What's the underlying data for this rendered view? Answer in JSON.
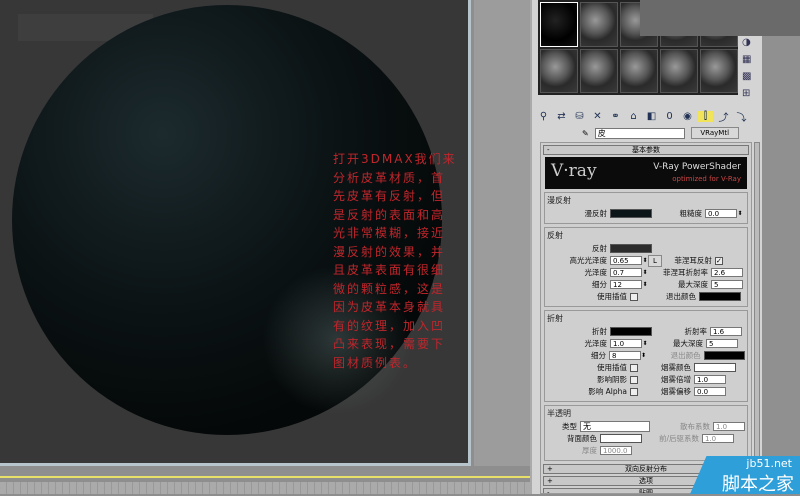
{
  "note_text": "打开3DMAX我们来分析皮革材质，首先皮革有反射，但是反射的表面和高光非常模糊，接近漫反射的效果，并且皮革表面有很细微的颗粒感，这是因为皮革本身就具有的纹理，加入凹凸来表现，需要下图材质例表。",
  "material_editor": {
    "material_name": "皮",
    "material_type": "VRayMtl",
    "rollout_basic": "基本参数",
    "banner": {
      "logo": "V·ray",
      "title": "V-Ray PowerShader",
      "subtitle": "optimized for V-Ray"
    },
    "diffuse": {
      "group": "漫反射",
      "diffuse_label": "漫反射",
      "roughness_label": "粗糙度",
      "roughness": "0.0"
    },
    "reflection": {
      "group": "反射",
      "reflect_label": "反射",
      "hilight_gloss_label": "高光光泽度",
      "hilight_gloss": "0.65",
      "L": "L",
      "gloss_label": "光泽度",
      "gloss": "0.7",
      "subdivs_label": "细分",
      "subdivs": "12",
      "interp_label": "使用插值",
      "fresnel_label": "菲涅耳反射",
      "fresnel_ior_label": "菲涅耳折射率",
      "fresnel_ior": "2.6",
      "max_depth_label": "最大深度",
      "max_depth": "5",
      "exit_color_label": "退出颜色"
    },
    "refraction": {
      "group": "折射",
      "refract_label": "折射",
      "ior_label": "折射率",
      "ior": "1.6",
      "gloss_label": "光泽度",
      "gloss": "1.0",
      "max_depth_label": "最大深度",
      "max_depth": "5",
      "subdivs_label": "细分",
      "subdivs": "8",
      "exit_color_label": "退出颜色",
      "interp_label": "使用插值",
      "fog_color_label": "烟雾颜色",
      "shadows_label": "影响阴影",
      "fog_mult_label": "烟雾倍增",
      "fog_mult": "1.0",
      "alpha_label": "影响 Alpha",
      "fog_bias_label": "烟雾偏移",
      "fog_bias": "0.0"
    },
    "translucency": {
      "group": "半透明",
      "type_label": "类型",
      "type": "无",
      "scatter_label": "散布系数",
      "scatter": "1.0",
      "back_color_label": "背面颜色",
      "fb_label": "前/后驱系数",
      "fb": "1.0",
      "thickness_label": "厚度",
      "thickness": "1000.0"
    },
    "rollouts": [
      {
        "sign": "+",
        "label": "双向反射分布"
      },
      {
        "sign": "+",
        "label": "选项"
      },
      {
        "sign": "-",
        "label": "贴图"
      }
    ]
  },
  "watermark": {
    "site": "jb51.net",
    "name": "脚本之家"
  }
}
